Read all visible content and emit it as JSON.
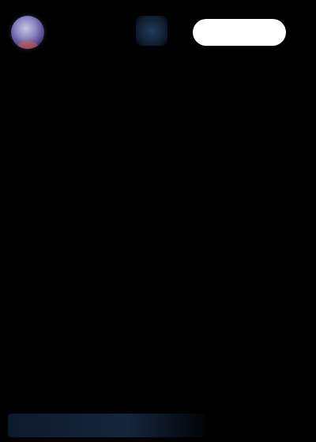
{
  "header": {
    "title": "",
    "follow_label": ""
  },
  "body": {
    "lines": [
      "",
      "",
      "",
      "",
      "",
      "",
      "",
      "",
      "",
      "",
      "",
      "",
      ""
    ]
  },
  "colors": {
    "background": "#000000",
    "button_bg": "#ffffff",
    "text_dim": "#3a3a40"
  },
  "icons": {
    "avatar": "user-avatar",
    "badge": "verified-badge-icon"
  }
}
